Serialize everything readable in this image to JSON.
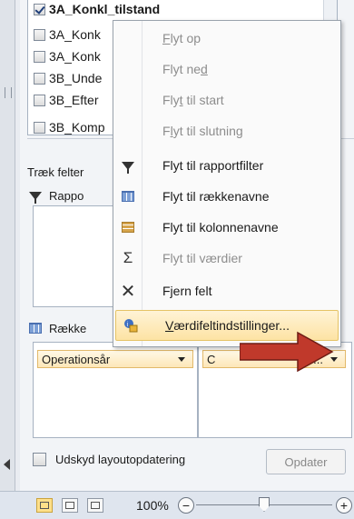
{
  "field_list": {
    "fields": [
      {
        "label": "3A_Konkl_tilstand",
        "checked": true,
        "bold": true
      },
      {
        "label": "3A_Konk",
        "checked": false,
        "bold": false
      },
      {
        "label": "3A_Konk",
        "checked": false,
        "bold": false
      },
      {
        "label": "3B_Unde",
        "checked": false,
        "bold": false
      },
      {
        "label": "3B_Efter",
        "checked": false,
        "bold": false
      },
      {
        "label": "3B_Komp",
        "checked": false,
        "bold": false
      }
    ]
  },
  "drag_fields_label": "Træk felter",
  "report_filter_label": "Rappo",
  "row_labels_label": "Række",
  "row_chip": {
    "label": "Operationsår"
  },
  "value_chip": {
    "label": "C",
    "ellipsis": "..."
  },
  "defer_label": "Udskyd layoutopdatering",
  "update_button": "Opdater",
  "zoom": {
    "value": "100%",
    "minus": "−",
    "plus": "+"
  },
  "context_menu": [
    {
      "pre": "",
      "key": "F",
      "post": "lyt op",
      "disabled": true,
      "icon": ""
    },
    {
      "pre": "Flyt ne",
      "key": "d",
      "post": "",
      "disabled": true,
      "icon": ""
    },
    {
      "pre": "Fly",
      "key": "t",
      "post": " til start",
      "disabled": true,
      "icon": ""
    },
    {
      "pre": "F",
      "key": "l",
      "post": "yt til slutning",
      "disabled": true,
      "icon": ""
    },
    {
      "pre": "Flyt til rapportfilter",
      "key": "",
      "post": "",
      "disabled": false,
      "icon": "filter-icon"
    },
    {
      "pre": "Flyt til rækkenavne",
      "key": "",
      "post": "",
      "disabled": false,
      "icon": "row-labels-icon"
    },
    {
      "pre": "Flyt til kolonnenavne",
      "key": "",
      "post": "",
      "disabled": false,
      "icon": "column-labels-icon"
    },
    {
      "pre": "Flyt til værdier",
      "key": "",
      "post": "",
      "disabled": true,
      "icon": "sigma-icon"
    },
    {
      "pre": "Fjern felt",
      "key": "",
      "post": "",
      "disabled": false,
      "icon": "remove-icon"
    },
    {
      "pre": "",
      "key": "V",
      "post": "ærdifeltindstillinger...",
      "disabled": false,
      "icon": "value-settings-icon",
      "highlight": true
    }
  ],
  "icons": {
    "filter": "▼",
    "sigma": "Σ",
    "remove": "✕"
  },
  "colors": {
    "highlight": "#fde3a4",
    "chip": "#fde7b8",
    "arrow": "#c0392b"
  }
}
